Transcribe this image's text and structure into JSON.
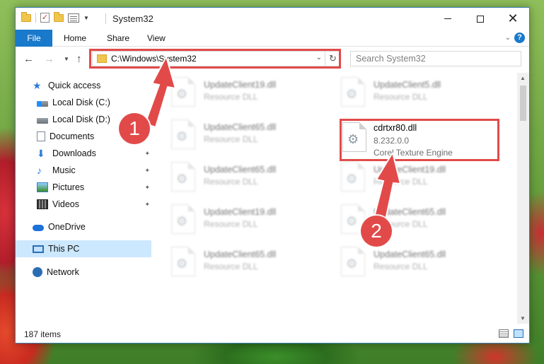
{
  "window": {
    "title": "System32"
  },
  "ribbon": {
    "tabs": [
      "File",
      "Home",
      "Share",
      "View"
    ]
  },
  "address_bar": {
    "path": "C:\\Windows\\System32"
  },
  "search": {
    "placeholder": "Search System32"
  },
  "sidebar": {
    "quick_access": "Quick access",
    "items": [
      {
        "label": "Local Disk (C:)",
        "pinned": true
      },
      {
        "label": "Local Disk (D:)",
        "pinned": true
      },
      {
        "label": "Documents",
        "pinned": true
      },
      {
        "label": "Downloads",
        "pinned": true
      },
      {
        "label": "Music",
        "pinned": true
      },
      {
        "label": "Pictures",
        "pinned": true
      },
      {
        "label": "Videos",
        "pinned": true
      }
    ],
    "onedrive": "OneDrive",
    "this_pc": "This PC",
    "network": "Network"
  },
  "files": {
    "left_column": [
      {
        "name": "UpdateClient19.dll",
        "type": "Resource DLL"
      },
      {
        "name": "UpdateClient65.dll",
        "type": "Resource DLL"
      },
      {
        "name": "UpdateClient65.dll",
        "type": "Resource DLL"
      },
      {
        "name": "UpdateClient19.dll",
        "type": "Resource DLL"
      },
      {
        "name": "UpdateClient65.dll",
        "type": "Resource DLL"
      }
    ],
    "right_column": [
      {
        "name": "UpdateClient5.dll",
        "type": "Resource DLL"
      },
      {
        "name": "UpdateClient19.dll",
        "type": "Resource DLL"
      },
      {
        "name": "UpdateClient65.dll",
        "type": "Resource DLL"
      },
      {
        "name": "UpdateClient65.dll",
        "type": "Resource DLL"
      }
    ],
    "highlighted": {
      "name": "cdrtxr80.dll",
      "version": "8.232.0.0",
      "description": "Corel Texture Engine"
    }
  },
  "status": {
    "item_count": "187 items"
  },
  "annotations": {
    "step1": "1",
    "step2": "2",
    "color": "#e24a4a"
  }
}
